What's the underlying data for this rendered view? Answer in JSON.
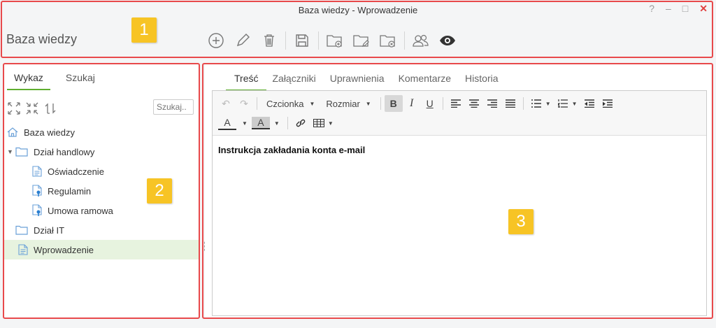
{
  "window": {
    "title": "Baza wiedzy - Wprowadzenie",
    "help": "?",
    "minimize": "–",
    "maximize": "□",
    "close": "✕"
  },
  "app": {
    "title": "Baza wiedzy"
  },
  "toolbar": {
    "buttons": [
      "add-icon",
      "edit-icon",
      "delete-icon",
      "save-icon",
      "new-folder-icon",
      "rename-folder-icon",
      "delete-folder-icon",
      "users-icon",
      "preview-icon"
    ]
  },
  "annotations": {
    "one": "1",
    "two": "2",
    "three": "3",
    "color": "#e8494b",
    "badge_color": "#f7c425"
  },
  "left": {
    "tabs": [
      "Wykaz",
      "Szukaj"
    ],
    "search_placeholder": "Szukaj..",
    "tree": [
      {
        "label": "Baza wiedzy",
        "type": "home"
      },
      {
        "label": "Dział handlowy",
        "type": "folder",
        "expanded": true
      },
      {
        "label": "Oświadczenie",
        "type": "doc"
      },
      {
        "label": "Regulamin",
        "type": "doc-pin"
      },
      {
        "label": "Umowa ramowa",
        "type": "doc-pin"
      },
      {
        "label": "Dział IT",
        "type": "folder"
      },
      {
        "label": "Wprowadzenie",
        "type": "doc",
        "selected": true
      }
    ]
  },
  "right": {
    "tabs": [
      "Treść",
      "Załączniki",
      "Uprawnienia",
      "Komentarze",
      "Historia"
    ],
    "editor": {
      "font_label": "Czcionka",
      "size_label": "Rozmiar",
      "bold": "B",
      "italic": "I",
      "underline": "U",
      "font_color": "A",
      "bg_color": "A"
    },
    "content": {
      "heading": "Instrukcja zakładania konta e-mail"
    }
  },
  "accent": "#5fae2f"
}
